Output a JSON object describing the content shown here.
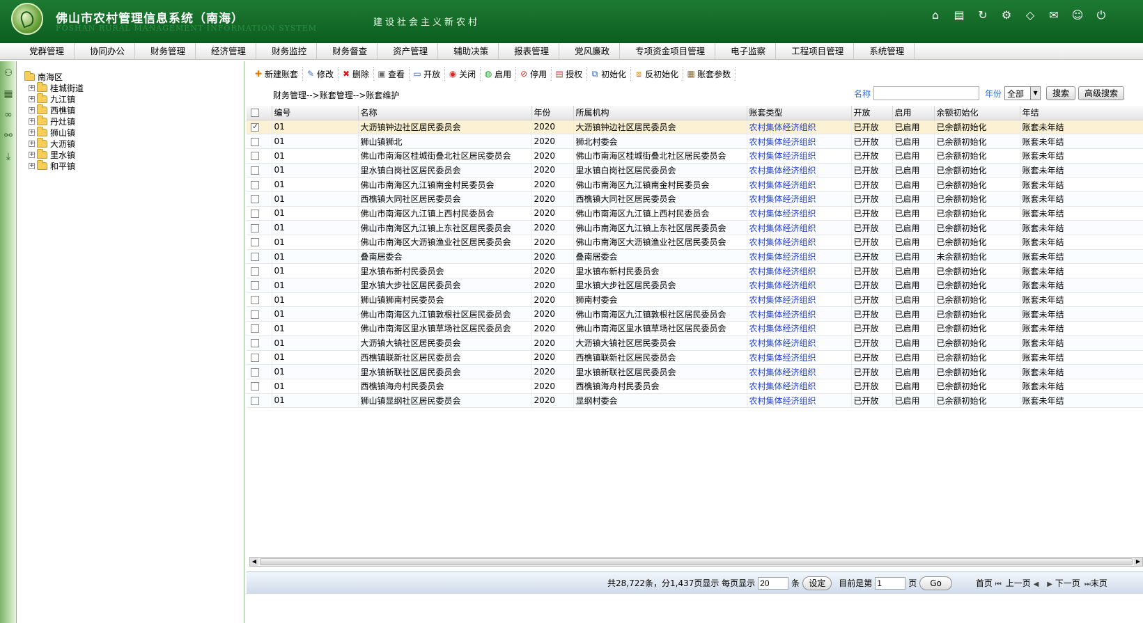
{
  "header": {
    "title": "佛山市农村管理信息系统（南海）",
    "subtitle_en": "FOSHAN RURAL MANAGEMENT INFORMATION SYSTEM",
    "slogan": "建设社会主义新农村"
  },
  "nav": [
    "党群管理",
    "协同办公",
    "财务管理",
    "经济管理",
    "财务监控",
    "财务督查",
    "资产管理",
    "辅助决策",
    "报表管理",
    "党风廉政",
    "专项资金项目管理",
    "电子监察",
    "工程项目管理",
    "系统管理"
  ],
  "tree": {
    "root": "南海区",
    "children": [
      "桂城街道",
      "九江镇",
      "西樵镇",
      "丹灶镇",
      "狮山镇",
      "大沥镇",
      "里水镇",
      "和平镇"
    ]
  },
  "toolbar": {
    "new": "新建账套",
    "edit": "修改",
    "delete": "删除",
    "view": "查看",
    "open": "开放",
    "close": "关闭",
    "enable": "启用",
    "disable": "停用",
    "authorize": "授权",
    "init": "初始化",
    "reinit": "反初始化",
    "params": "账套参数"
  },
  "breadcrumb": "财务管理-->账套管理-->账套维护",
  "search": {
    "name_label": "名称",
    "name_value": "",
    "year_label": "年份",
    "year_value": "全部",
    "search_btn": "搜索",
    "advanced_btn": "高级搜索"
  },
  "table": {
    "headers": [
      "编号",
      "名称",
      "年份",
      "所属机构",
      "账套类型",
      "开放",
      "启用",
      "余额初始化",
      "年结"
    ],
    "rows": [
      {
        "code": "01",
        "name": "大沥镇钟边社区居民委员会",
        "year": "2020",
        "org": "大沥镇钟边社区居民委员会",
        "type": "农村集体经济组织",
        "open": "已开放",
        "enabled": "已启用",
        "init": "已余额初始化",
        "close": "账套未年结",
        "checked": true
      },
      {
        "code": "01",
        "name": "狮山镇狮北",
        "year": "2020",
        "org": "狮北村委会",
        "type": "农村集体经济组织",
        "open": "已开放",
        "enabled": "已启用",
        "init": "已余额初始化",
        "close": "账套未年结"
      },
      {
        "code": "01",
        "name": "佛山市南海区桂城街叠北社区居民委员会",
        "year": "2020",
        "org": "佛山市南海区桂城街叠北社区居民委员会",
        "type": "农村集体经济组织",
        "open": "已开放",
        "enabled": "已启用",
        "init": "已余额初始化",
        "close": "账套未年结"
      },
      {
        "code": "01",
        "name": "里水镇白岗社区居民委员会",
        "year": "2020",
        "org": "里水镇白岗社区居民委员会",
        "type": "农村集体经济组织",
        "open": "已开放",
        "enabled": "已启用",
        "init": "已余额初始化",
        "close": "账套未年结"
      },
      {
        "code": "01",
        "name": "佛山市南海区九江镇南金村民委员会",
        "year": "2020",
        "org": "佛山市南海区九江镇南金村民委员会",
        "type": "农村集体经济组织",
        "open": "已开放",
        "enabled": "已启用",
        "init": "已余额初始化",
        "close": "账套未年结"
      },
      {
        "code": "01",
        "name": "西樵镇大同社区居民委员会",
        "year": "2020",
        "org": "西樵镇大同社区居民委员会",
        "type": "农村集体经济组织",
        "open": "已开放",
        "enabled": "已启用",
        "init": "已余额初始化",
        "close": "账套未年结"
      },
      {
        "code": "01",
        "name": "佛山市南海区九江镇上西村民委员会",
        "year": "2020",
        "org": "佛山市南海区九江镇上西村民委员会",
        "type": "农村集体经济组织",
        "open": "已开放",
        "enabled": "已启用",
        "init": "已余额初始化",
        "close": "账套未年结"
      },
      {
        "code": "01",
        "name": "佛山市南海区九江镇上东社区居民委员会",
        "year": "2020",
        "org": "佛山市南海区九江镇上东社区居民委员会",
        "type": "农村集体经济组织",
        "open": "已开放",
        "enabled": "已启用",
        "init": "已余额初始化",
        "close": "账套未年结"
      },
      {
        "code": "01",
        "name": "佛山市南海区大沥镇渔业社区居民委员会",
        "year": "2020",
        "org": "佛山市南海区大沥镇渔业社区居民委员会",
        "type": "农村集体经济组织",
        "open": "已开放",
        "enabled": "已启用",
        "init": "已余额初始化",
        "close": "账套未年结"
      },
      {
        "code": "01",
        "name": "叠南居委会",
        "year": "2020",
        "org": "叠南居委会",
        "type": "农村集体经济组织",
        "open": "已开放",
        "enabled": "已启用",
        "init": "未余额初始化",
        "close": "账套未年结"
      },
      {
        "code": "01",
        "name": "里水镇布新村民委员会",
        "year": "2020",
        "org": "里水镇布新村民委员会",
        "type": "农村集体经济组织",
        "open": "已开放",
        "enabled": "已启用",
        "init": "已余额初始化",
        "close": "账套未年结"
      },
      {
        "code": "01",
        "name": "里水镇大步社区居民委员会",
        "year": "2020",
        "org": "里水镇大步社区居民委员会",
        "type": "农村集体经济组织",
        "open": "已开放",
        "enabled": "已启用",
        "init": "已余额初始化",
        "close": "账套未年结"
      },
      {
        "code": "01",
        "name": "狮山镇狮南村民委员会",
        "year": "2020",
        "org": "狮南村委会",
        "type": "农村集体经济组织",
        "open": "已开放",
        "enabled": "已启用",
        "init": "已余额初始化",
        "close": "账套未年结"
      },
      {
        "code": "01",
        "name": "佛山市南海区九江镇敦根社区居民委员会",
        "year": "2020",
        "org": "佛山市南海区九江镇敦根社区居民委员会",
        "type": "农村集体经济组织",
        "open": "已开放",
        "enabled": "已启用",
        "init": "已余额初始化",
        "close": "账套未年结"
      },
      {
        "code": "01",
        "name": "佛山市南海区里水镇草场社区居民委员会",
        "year": "2020",
        "org": "佛山市南海区里水镇草场社区居民委员会",
        "type": "农村集体经济组织",
        "open": "已开放",
        "enabled": "已启用",
        "init": "已余额初始化",
        "close": "账套未年结"
      },
      {
        "code": "01",
        "name": "大沥镇大镇社区居民委员会",
        "year": "2020",
        "org": "大沥镇大镇社区居民委员会",
        "type": "农村集体经济组织",
        "open": "已开放",
        "enabled": "已启用",
        "init": "已余额初始化",
        "close": "账套未年结"
      },
      {
        "code": "01",
        "name": "西樵镇联新社区居民委员会",
        "year": "2020",
        "org": "西樵镇联新社区居民委员会",
        "type": "农村集体经济组织",
        "open": "已开放",
        "enabled": "已启用",
        "init": "已余额初始化",
        "close": "账套未年结"
      },
      {
        "code": "01",
        "name": "里水镇新联社区居民委员会",
        "year": "2020",
        "org": "里水镇新联社区居民委员会",
        "type": "农村集体经济组织",
        "open": "已开放",
        "enabled": "已启用",
        "init": "已余额初始化",
        "close": "账套未年结"
      },
      {
        "code": "01",
        "name": "西樵镇海舟村民委员会",
        "year": "2020",
        "org": "西樵镇海舟村民委员会",
        "type": "农村集体经济组织",
        "open": "已开放",
        "enabled": "已启用",
        "init": "已余额初始化",
        "close": "账套未年结"
      },
      {
        "code": "01",
        "name": "狮山镇显纲社区居民委员会",
        "year": "2020",
        "org": "显纲村委会",
        "type": "农村集体经济组织",
        "open": "已开放",
        "enabled": "已启用",
        "init": "已余额初始化",
        "close": "账套未年结"
      }
    ]
  },
  "pager": {
    "summary": "共28,722条，分1,437页显示 每页显示",
    "page_size": "20",
    "unit": "条",
    "set_btn": "设定",
    "current_label": "目前是第",
    "current_page": "1",
    "page_unit": "页",
    "go_btn": "Go",
    "first": "首页",
    "prev": "上一页",
    "next": "下一页",
    "last": "末页"
  },
  "colors": {
    "header_green": "#0b5e1f",
    "link_blue": "#1e3fcf",
    "selected_row": "#fcf1d2"
  }
}
